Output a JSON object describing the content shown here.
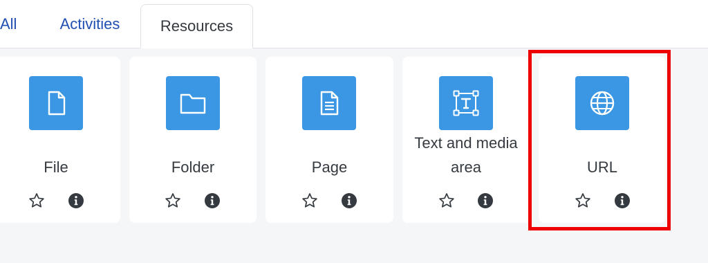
{
  "tabs": [
    {
      "label": "All"
    },
    {
      "label": "Activities"
    },
    {
      "label": "Resources",
      "active": true
    }
  ],
  "cards": [
    {
      "label": "File",
      "icon": "file-icon"
    },
    {
      "label": "Folder",
      "icon": "folder-icon"
    },
    {
      "label": "Page",
      "icon": "page-icon"
    },
    {
      "label": "Text and media area",
      "line1": "Text and media",
      "line2": "area",
      "icon": "text-media-icon"
    },
    {
      "label": "URL",
      "icon": "url-globe-icon"
    }
  ],
  "colors": {
    "icon_bg": "#3b97e3",
    "tab_link": "#1f4fb3",
    "highlight": "#ee0000",
    "page_bg": "#f5f6f8"
  }
}
